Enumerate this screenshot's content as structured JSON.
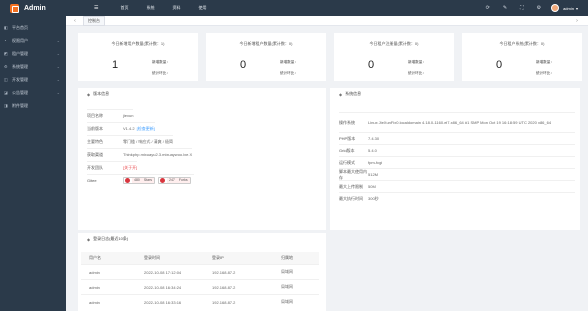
{
  "app": {
    "name": "Admin"
  },
  "topnav": {
    "menu_icon": "☰",
    "items": [
      "首页",
      "系统",
      "资料",
      "使用"
    ]
  },
  "topright": {
    "icons": [
      "refresh-icon",
      "edit-icon",
      "fullscreen-icon",
      "lang-icon"
    ],
    "glyphs": [
      "⟳",
      "✎",
      "⛶",
      "⚙"
    ],
    "username": "admin"
  },
  "sidebar": {
    "items": [
      {
        "label": "平台首页",
        "icon": "◧",
        "has_children": false
      },
      {
        "label": "权限用户",
        "icon": "◔",
        "has_children": true
      },
      {
        "label": "租户管理",
        "icon": "◩",
        "has_children": true
      },
      {
        "label": "系统管理",
        "icon": "⚙",
        "has_children": true
      },
      {
        "label": "开发管理",
        "icon": "◫",
        "has_children": true
      },
      {
        "label": "公告管理",
        "icon": "◪",
        "has_children": true
      },
      {
        "label": "附件管理",
        "icon": "◨",
        "has_children": false
      }
    ]
  },
  "tabs": {
    "active": "控制台"
  },
  "stats": [
    {
      "title": "今日新增用户数量(累计数：1)",
      "value": "1",
      "sub1": "新增数量：",
      "sub2": "统计环比："
    },
    {
      "title": "今日新增租户数量(累计数：0)",
      "value": "0",
      "sub1": "新增数量：",
      "sub2": "统计环比："
    },
    {
      "title": "今日租户注册量(累计数：0)",
      "value": "0",
      "sub1": "新增数量：",
      "sub2": "统计环比："
    },
    {
      "title": "今日租户系统(累计数：0)",
      "value": "0",
      "sub1": "新增数量：",
      "sub2": "统计环比："
    }
  ],
  "version_panel": {
    "title": "版本信息",
    "rows": [
      {
        "k": "项目名称",
        "v": "jiexun"
      },
      {
        "k": "当前版本",
        "v": "V1.4.2",
        "link": "[检查更新]"
      },
      {
        "k": "主要特色",
        "v": "零门槛 / 响应式 / 清爽 / 极简"
      },
      {
        "k": "获取渠道",
        "v": "Thinkphp.mixuayu2.3.mixuaywoo.lxe.X"
      },
      {
        "k": "开发团队",
        "v": "",
        "link": "[关于开]"
      },
      {
        "k": "Gitee",
        "badges": [
          {
            "label": "Stars",
            "num": "480"
          },
          {
            "label": "Forks",
            "num": "247"
          }
        ]
      }
    ]
  },
  "system_panel": {
    "title": "系统信息",
    "rows": [
      {
        "k": "操作系统",
        "v": "Linux JieXunFix0.localdomain 4.18.0-1160.el7.x86_64 #1 SMP Mon Oct 19 16:18:59 UTC 2020 x86_64"
      },
      {
        "k": "PHP版本",
        "v": "7.4.30"
      },
      {
        "k": "Grid版本",
        "v": "5.4.0"
      },
      {
        "k": "运行模式",
        "v": "fpm-fcgi"
      },
      {
        "k": "脚本最大使用内存",
        "v": "512M"
      },
      {
        "k": "最大上传限制",
        "v": "50M"
      },
      {
        "k": "最大执行时间",
        "v": "300秒"
      }
    ]
  },
  "login_panel": {
    "title": "登录日志(最近10条)",
    "headers": [
      "用户名",
      "登录时间",
      "登录IP",
      "归属地"
    ],
    "rows": [
      [
        "admin",
        "2022-10-08 17:12:04",
        "192.168.87.2",
        "局域网"
      ],
      [
        "admin",
        "2022-10-08 16:34:24",
        "192.168.87.2",
        "局域网"
      ],
      [
        "admin",
        "2022-10-08 16:33:16",
        "192.168.87.2",
        "局域网"
      ]
    ]
  }
}
